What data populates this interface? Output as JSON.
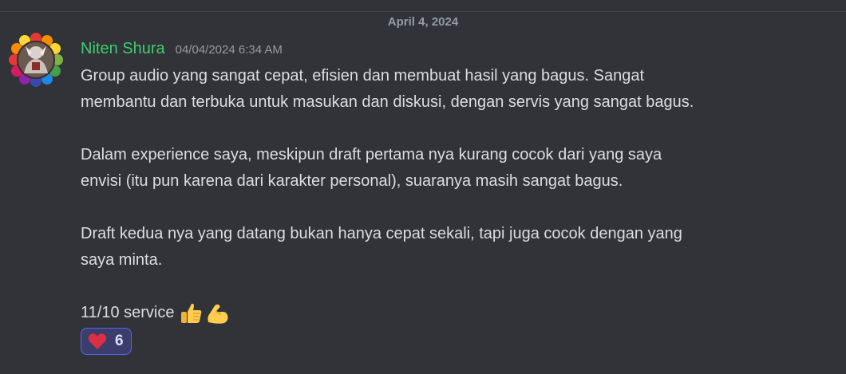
{
  "divider": {
    "date": "April 4, 2024"
  },
  "message": {
    "author": "Niten Shura",
    "timestamp": "04/04/2024 6:34 AM",
    "author_color": "#3ccf6a",
    "lines": [
      "Group audio yang sangat cepat, efisien dan membuat hasil yang bagus. Sangat",
      "membantu dan terbuka untuk masukan dan diskusi, dengan servis yang sangat bagus.",
      "Dalam experience saya, meskipun draft pertama nya kurang cocok dari yang saya",
      "envisi (itu pun karena dari karakter personal), suaranya masih sangat bagus.",
      "Draft kedua nya yang datang bukan hanya cepat sekali, tapi juga cocok dengan yang",
      "saya minta.",
      "11/10 service"
    ],
    "emojis": [
      "thumbs-up-icon",
      "flexed-biceps-icon"
    ]
  },
  "reaction": {
    "emoji": "heart-icon",
    "count": "6",
    "accent": "#5865f2"
  }
}
